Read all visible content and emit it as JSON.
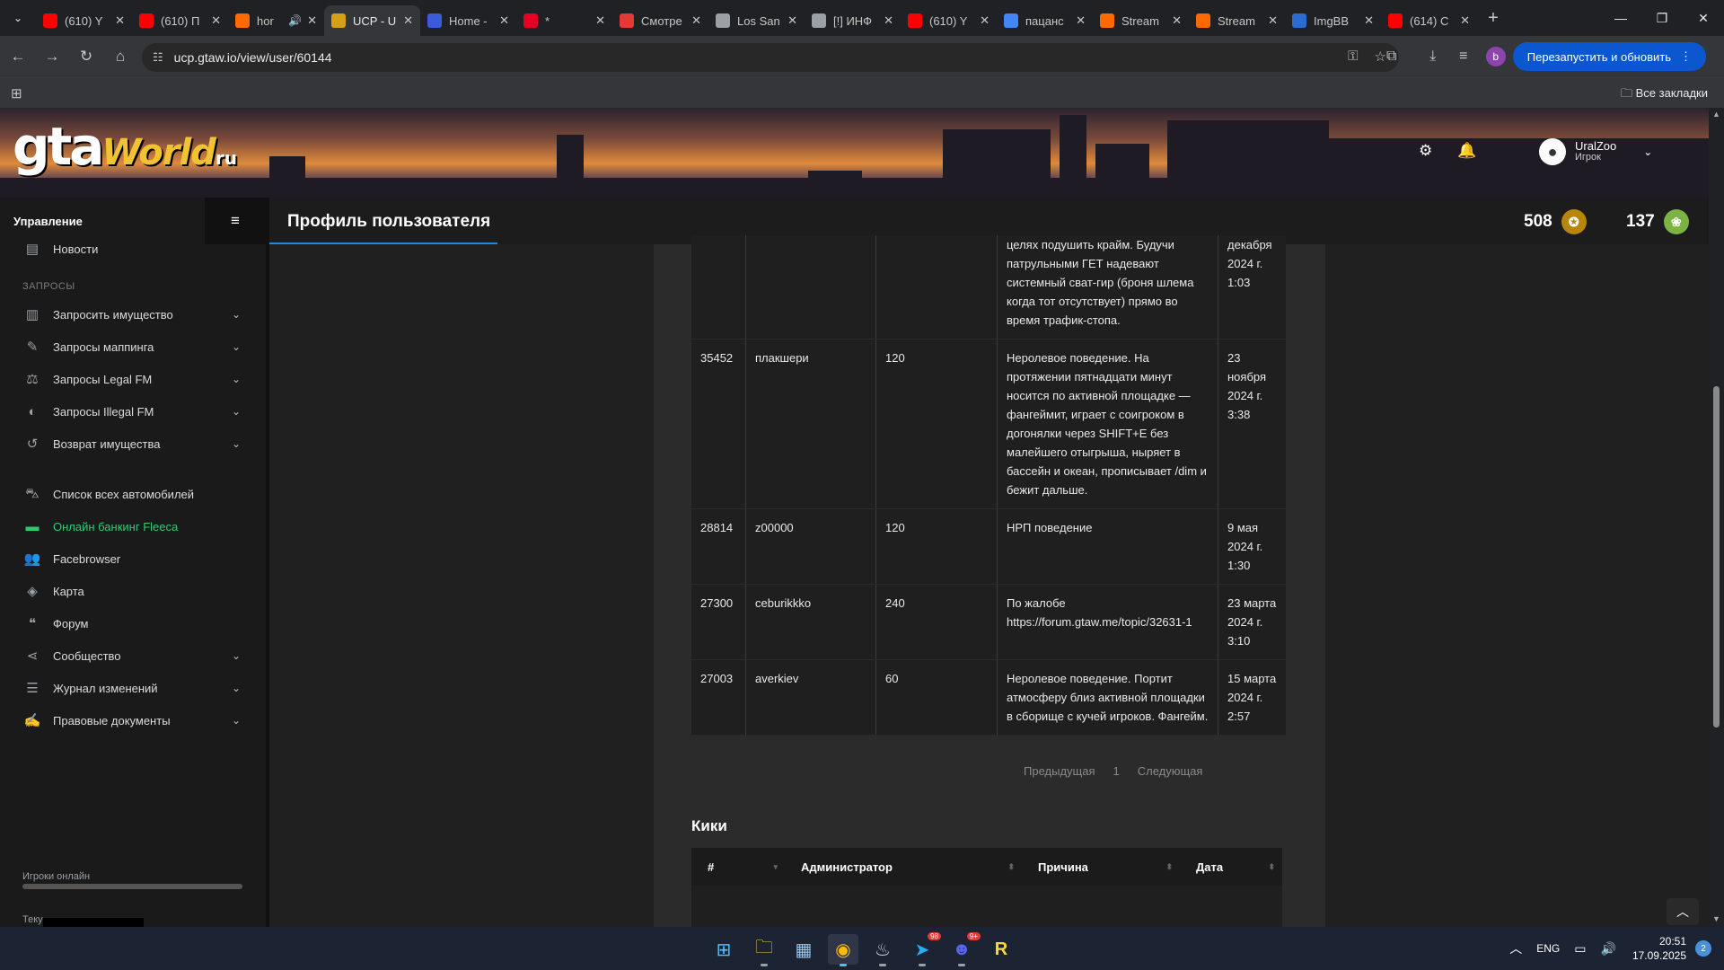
{
  "browser": {
    "tabs": [
      {
        "title": "(610) Y",
        "color": "#ff0000"
      },
      {
        "title": "(610) П",
        "color": "#ff0000"
      },
      {
        "title": "hor",
        "color": "#ff6a00"
      },
      {
        "title": "UCP - U",
        "color": "#d4a017"
      },
      {
        "title": "Home -",
        "color": "#3b5bdb"
      },
      {
        "title": "*",
        "color": "#e60023"
      },
      {
        "title": "Смотре",
        "color": "#e53935"
      },
      {
        "title": "Los San",
        "color": "#9aa0a6"
      },
      {
        "title": "[!] ИНФ",
        "color": "#9aa0a6"
      },
      {
        "title": "(610) Y",
        "color": "#ff0000"
      },
      {
        "title": "пацанс",
        "color": "#4285f4"
      },
      {
        "title": "Stream",
        "color": "#ff6a00"
      },
      {
        "title": "Stream",
        "color": "#ff6a00"
      },
      {
        "title": "ImgBB",
        "color": "#2a6cd1"
      },
      {
        "title": "(614) С",
        "color": "#ff0000"
      }
    ],
    "url": "ucp.gtaw.io/view/user/60144",
    "restart_label": "Перезапустить и обновить",
    "profile_letter": "b",
    "all_bookmarks": "Все закладки"
  },
  "site": {
    "logo_main": "gta",
    "logo_world": "World",
    "logo_ru": "ru",
    "user": {
      "name": "UralZoo",
      "role": "Игрок"
    },
    "page_title": "Профиль пользователя",
    "stats": [
      {
        "value": "508",
        "badge_color": "#b8860b"
      },
      {
        "value": "137",
        "badge_color": "#7cb342"
      }
    ]
  },
  "sidebar": {
    "header": "Управление",
    "top_item": "Новости",
    "section_requests": "ЗАПРОСЫ",
    "request_items": [
      {
        "label": "Запросить имущество",
        "icon": "building-icon"
      },
      {
        "label": "Запросы маппинга",
        "icon": "brush-icon"
      },
      {
        "label": "Запросы Legal FM",
        "icon": "scales-icon"
      },
      {
        "label": "Запросы Illegal FM",
        "icon": "mask-icon"
      },
      {
        "label": "Возврат имущества",
        "icon": "undo-icon"
      }
    ],
    "items": [
      {
        "label": "Список всех автомобилей",
        "icon": "car-icon"
      },
      {
        "label": "Онлайн банкинг Fleeca",
        "icon": "money-icon"
      },
      {
        "label": "Facebrowser",
        "icon": "users-icon"
      },
      {
        "label": "Карта",
        "icon": "map-icon"
      },
      {
        "label": "Форум",
        "icon": "comments-icon"
      },
      {
        "label": "Сообщество",
        "icon": "share-icon"
      },
      {
        "label": "Журнал изменений",
        "icon": "list-icon"
      },
      {
        "label": "Правовые документы",
        "icon": "document-icon"
      }
    ],
    "online_label": "Игроки онлайн",
    "current_label": "Теку"
  },
  "bans": {
    "partial": {
      "reason": "целях подушить крайм. Будучи патрульными ГЕТ надевают системный сват-гир (броня шлема когда тот отсутствует) прямо во время трафик-стопа.",
      "date": "декабря 2024 г. 1:03"
    },
    "rows": [
      {
        "id": "35452",
        "admin": "плакшери",
        "time": "120",
        "reason": "Неролевое поведение. На протяжении пятнадцати минут носится по активной площадке — фангеймит, играет с соигроком в догонялки через SHIFT+E без малейшего отыгрыша, ныряет в бассейн и океан, прописывает /dim и бежит дальше.",
        "date": "23 ноября 2024 г. 3:38"
      },
      {
        "id": "28814",
        "admin": "z00000",
        "time": "120",
        "reason": "НРП поведение",
        "date": "9 мая 2024 г. 1:30"
      },
      {
        "id": "27300",
        "admin": "ceburikkko",
        "time": "240",
        "reason": "По жалобе https://forum.gtaw.me/topic/32631-1",
        "date": "23 марта 2024 г. 3:10"
      },
      {
        "id": "27003",
        "admin": "averkiev",
        "time": "60",
        "reason": "Неролевое поведение. Портит атмосферу близ активной площадки в сборище с кучей игроков. Фангейм.",
        "date": "15 марта 2024 г. 2:57"
      }
    ],
    "pager": {
      "prev": "Предыдущая",
      "page": "1",
      "next": "Следующая"
    }
  },
  "kicks": {
    "title": "Кики",
    "columns": [
      "#",
      "Администратор",
      "Причина",
      "Дата"
    ]
  },
  "taskbar": {
    "telegram_badge": "98",
    "discord_badge": "9+",
    "lang": "ENG",
    "time": "20:51",
    "date": "17.09.2025",
    "notifications": "2"
  }
}
